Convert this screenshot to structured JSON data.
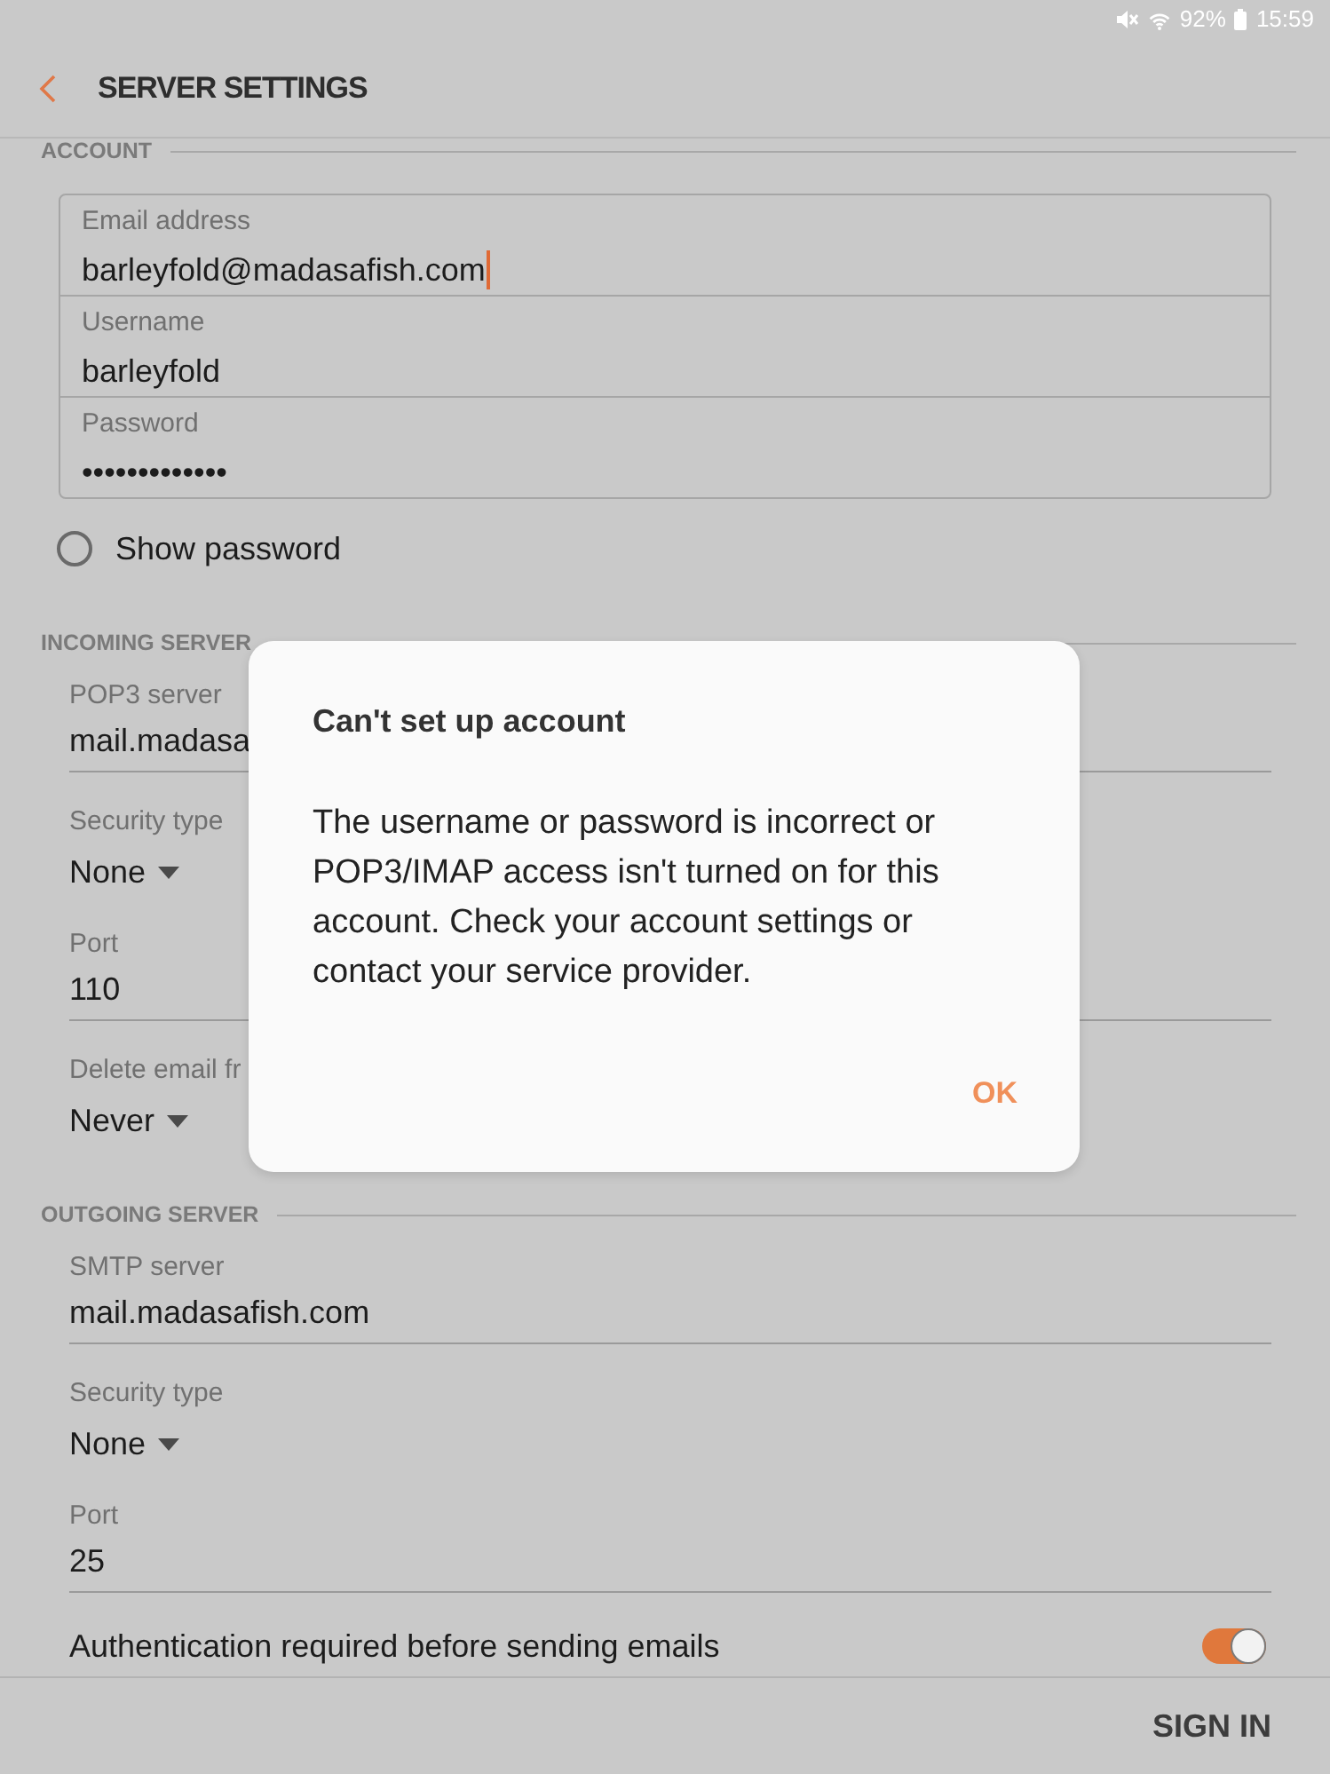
{
  "status_bar": {
    "battery": "92%",
    "time": "15:59"
  },
  "header": {
    "title": "SERVER SETTINGS"
  },
  "account": {
    "title": "ACCOUNT",
    "fields": [
      {
        "label": "Email address",
        "value": "barleyfold@madasafish.com",
        "focused": true
      },
      {
        "label": "Username",
        "value": "barleyfold",
        "focused": false
      },
      {
        "label": "Password",
        "value": "•••••••••••••",
        "focused": false
      }
    ],
    "show_password": {
      "label": "Show password",
      "checked": false
    }
  },
  "server_sections": [
    {
      "title": "INCOMING SERVER",
      "fields": [
        {
          "kind": "text",
          "label": "POP3 server",
          "value": "mail.madasa"
        },
        {
          "kind": "dropdown",
          "label": "Security type",
          "value": "None"
        },
        {
          "kind": "text",
          "label": "Port",
          "value": "110"
        },
        {
          "kind": "dropdown",
          "label": "Delete email fr",
          "value": "Never"
        }
      ]
    },
    {
      "title": "OUTGOING SERVER",
      "fields": [
        {
          "kind": "text",
          "label": "SMTP server",
          "value": "mail.madasafish.com"
        },
        {
          "kind": "dropdown",
          "label": "Security type",
          "value": "None"
        },
        {
          "kind": "text",
          "label": "Port",
          "value": "25"
        },
        {
          "kind": "toggle",
          "label": "Authentication required before sending emails",
          "on": true
        }
      ]
    }
  ],
  "footer": {
    "button": "SIGN IN"
  },
  "dialog": {
    "title": "Can't set up account",
    "message": "The username or password is incorrect or POP3/IMAP access isn't turned on for this account. Check your account settings or contact your service provider.",
    "button": "OK"
  }
}
